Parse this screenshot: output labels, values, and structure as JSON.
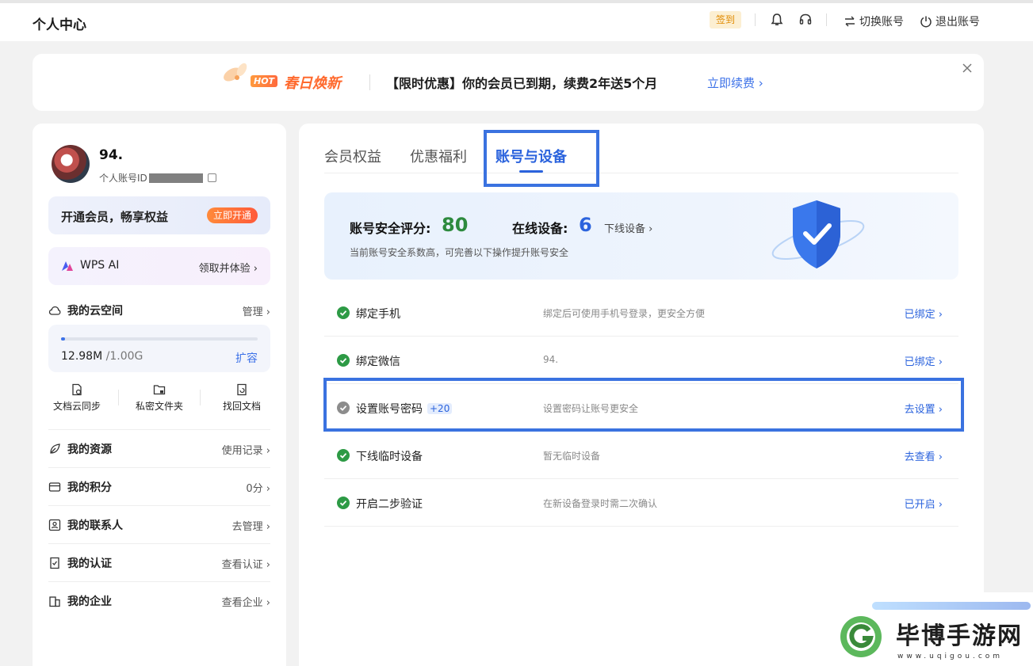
{
  "topbar": {
    "title": "个人中心",
    "signin": "签到",
    "switch_account": "切换账号",
    "logout": "退出账号"
  },
  "banner": {
    "hot": "HOT",
    "campaign": "春日焕新",
    "promo": "【限时优惠】你的会员已到期，续费2年送5个月",
    "renew": "立即续费 ›"
  },
  "profile": {
    "name": "94.",
    "id_label": "个人账号ID"
  },
  "vip": {
    "text": "开通会员，畅享权益",
    "button": "立即开通"
  },
  "wps_ai": {
    "label": "WPS AI",
    "action": "领取并体验 ›"
  },
  "cloud": {
    "title": "我的云空间",
    "manage": "管理 ›",
    "used": "12.98M",
    "total": " /1.00G",
    "used_fraction": 0.013,
    "expand": "扩容",
    "quick": [
      {
        "label": "文档云同步"
      },
      {
        "label": "私密文件夹"
      },
      {
        "label": "找回文档"
      }
    ]
  },
  "menu": [
    {
      "label": "我的资源",
      "right": "使用记录 ›"
    },
    {
      "label": "我的积分",
      "right": "0分 ›"
    },
    {
      "label": "我的联系人",
      "right": "去管理 ›"
    },
    {
      "label": "我的认证",
      "right": "查看认证 ›"
    },
    {
      "label": "我的企业",
      "right": "查看企业 ›"
    }
  ],
  "tabs": [
    {
      "label": "会员权益"
    },
    {
      "label": "优惠福利"
    },
    {
      "label": "账号与设备"
    }
  ],
  "security": {
    "score_label": "账号安全评分:",
    "score": "80",
    "devices_label": "在线设备:",
    "devices": "6",
    "offline": "下线设备 ›",
    "hint": "当前账号安全系数高，可完善以下操作提升账号安全"
  },
  "items": [
    {
      "name": "绑定手机",
      "points": "",
      "desc": "绑定后可使用手机号登录，更安全方便",
      "action": "已绑定 ›",
      "done": true
    },
    {
      "name": "绑定微信",
      "points": "",
      "desc": "94.",
      "action": "已绑定 ›",
      "done": true
    },
    {
      "name": "设置账号密码",
      "points": "+20",
      "desc": "设置密码让账号更安全",
      "action": "去设置 ›",
      "done": false
    },
    {
      "name": "下线临时设备",
      "points": "",
      "desc": "暂无临时设备",
      "action": "去查看 ›",
      "done": true
    },
    {
      "name": "开启二步验证",
      "points": "",
      "desc": "在新设备登录时需二次确认",
      "action": "已开启 ›",
      "done": true
    }
  ],
  "watermark": {
    "brand": "毕博手游网",
    "url": "www.uqigou.com"
  },
  "colors": {
    "accent": "#2b63dd",
    "success": "#2d8a3e",
    "highlight": "#3a72e0",
    "hot": "#ff6a2e"
  }
}
